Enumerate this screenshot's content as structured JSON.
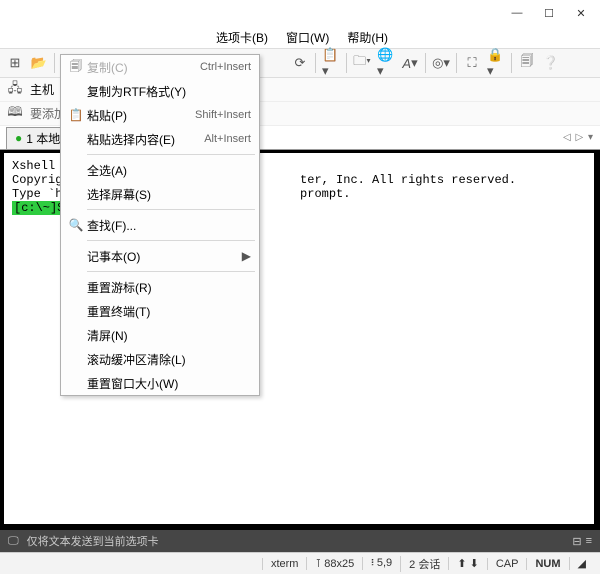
{
  "window": {
    "min": "—",
    "max": "☐",
    "close": "✕"
  },
  "menubar": {
    "tabs": "选项卡(B)",
    "window": "窗口(W)",
    "help": "帮助(H)"
  },
  "hostbar": {
    "label": "主机"
  },
  "addbar": {
    "label": "要添加"
  },
  "tab": {
    "bullet": "●",
    "label": "1 本地S"
  },
  "tabbar": {
    "nav": "◁ ▷ ▾"
  },
  "terminal": {
    "line1": "Xshell 5 ",
    "line2": "Copyright                               ter, Inc. All rights reserved.",
    "line3": "",
    "line4": "Type `hel                               prompt.",
    "prompt": "[c:\\~]$"
  },
  "dark_status": {
    "text": "仅将文本发送到当前选项卡",
    "r1": "⊟",
    "r2": "≡"
  },
  "status": {
    "s1": "xterm",
    "s2": "⊺ 88x25",
    "s3": "፧ 5,9",
    "s4": "2 会话",
    "s5": "⬆ ⬇",
    "cap": "CAP",
    "num": "NUM"
  },
  "ctx": {
    "copy": "复制(C)",
    "copy_accel": "Ctrl+Insert",
    "copy_rtf": "复制为RTF格式(Y)",
    "paste": "粘贴(P)",
    "paste_accel": "Shift+Insert",
    "paste_sel": "粘贴选择内容(E)",
    "paste_sel_accel": "Alt+Insert",
    "select_all": "全选(A)",
    "select_screen": "选择屏幕(S)",
    "find": "查找(F)...",
    "notepad": "记事本(O)",
    "reset_cursor": "重置游标(R)",
    "reset_term": "重置终端(T)",
    "clear": "清屏(N)",
    "clear_scroll": "滚动缓冲区清除(L)",
    "reset_size": "重置窗口大小(W)"
  }
}
